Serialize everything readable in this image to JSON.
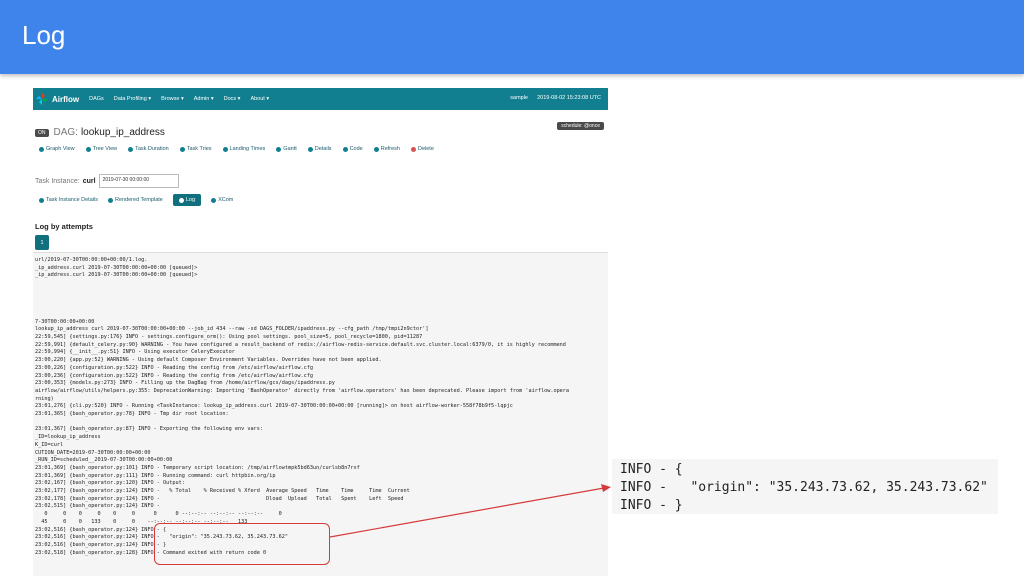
{
  "slide": {
    "title": "Log"
  },
  "navbar": {
    "brand": "Airflow",
    "items": [
      "DAGs",
      "Data Profiling ▾",
      "Browse ▾",
      "Admin ▾",
      "Docs ▾",
      "About ▾"
    ],
    "user": "sample",
    "datetime": "2019-08-02 15:23:08 UTC"
  },
  "dag": {
    "state_badge": "ON",
    "prefix": "DAG:",
    "name": "lookup_ip_address",
    "schedule_badge": "schedule: @once"
  },
  "toolbar": {
    "buttons": [
      "Graph View",
      "Tree View",
      "Task Duration",
      "Task Tries",
      "Landing Times",
      "Gantt",
      "Details",
      "Code",
      "Refresh",
      "Delete"
    ]
  },
  "task_instance": {
    "label": "Task Instance:",
    "name": "curl",
    "date": "2019-07-30 00:00:00"
  },
  "tabs": {
    "items": [
      "Task Instance Details",
      "Rendered Template",
      "Log",
      "XCom"
    ]
  },
  "log": {
    "heading": "Log by attempts",
    "attempt": "1",
    "lines": [
      "url/2019-07-30T00:00:00+00:00/1.log.",
      "_ip_address.curl 2019-07-30T00:00:00+00:00 [queued]>",
      "_ip_address.curl 2019-07-30T00:00:00+00:00 [queued]>",
      "",
      "",
      "",
      "",
      "",
      "7-30T00:00:00+00:00",
      "lookup_ip_address curl 2019-07-30T00:00:00+00:00 --job_id 434 --raw -sd DAGS_FOLDER/ipaddress.py --cfg_path /tmp/tmpi2n9ctor']",
      "22:59,545] {settings.py:176} INFO - settings.configure_orm(): Using pool settings. pool_size=5, pool_recycle=1800, pid=11287",
      "22:59,991] {default_celery.py:90} WARNING - You have configured a result_backend of redis://airflow-redis-service.default.svc.cluster.local:6379/0, it is highly recommend",
      "22:59,994] {__init__.py:51} INFO - Using executor CeleryExecutor",
      "23:00,220] {app.py:52} WARNING - Using default Composer Environment Variables. Overrides have not been applied.",
      "23:00,226] {configuration.py:522} INFO - Reading the config from /etc/airflow/airflow.cfg",
      "23:00,236] {configuration.py:522} INFO - Reading the config from /etc/airflow/airflow.cfg",
      "23:00,353] {models.py:273} INFO - Filling up the DagBag from /home/airflow/gcs/dags/ipaddress.py",
      "airflow/airflow/utils/helpers.py:355: DeprecationWarning: Importing 'BashOperator' directly from 'airflow.operators' has been deprecated. Please import from 'airflow.opera",
      "rning)",
      "23:01,276] {cli.py:520} INFO - Running <TaskInstance: lookup_ip_address.curl 2019-07-30T00:00:00+00:00 [running]> on host airflow-worker-558f78b9f5-lqpjc",
      "23:01,365] {bash_operator.py:78} INFO - Tmp dir root location:",
      "",
      "23:01,367] {bash_operator.py:87} INFO - Exporting the following env vars:",
      "_ID=lookup_ip_address",
      "K_ID=curl",
      "CUTION_DATE=2019-07-30T00:00:00+00:00",
      "_RUN_ID=scheduled__2019-07-30T00:00:00+00:00",
      "23:01,369] {bash_operator.py:101} INFO - Temporary script location: /tmp/airflowtmpk5bd63un/curlsb8n7rxf",
      "23:01,369] {bash_operator.py:111} INFO - Running command: curl httpbin.org/ip",
      "23:02,167] {bash_operator.py:120} INFO - Output:",
      "23:02,177] {bash_operator.py:124} INFO -   % Total    % Received % Xferd  Average Speed   Time    Time     Time  Current",
      "23:02,178] {bash_operator.py:124} INFO -                                  Dload  Upload   Total   Spent    Left  Speed",
      "23:02,515] {bash_operator.py:124} INFO -",
      "   0     0    0     0    0     0      0      0 --:--:-- --:--:-- --:--:--     0",
      "  45     0    0   133    0     0    --:--:-- --:--:-- --:--:--   133",
      "23:02,516] {bash_operator.py:124} INFO - {",
      "23:02,516] {bash_operator.py:124} INFO -   \"origin\": \"35.243.73.62, 35.243.73.62\"",
      "23:02,516] {bash_operator.py:124} INFO - }",
      "23:02,518] {bash_operator.py:128} INFO - Command exited with return code 0"
    ]
  },
  "zoom": {
    "lines": [
      "INFO - {",
      "INFO -   \"origin\": \"35.243.73.62, 35.243.73.62\"",
      "INFO - }"
    ]
  },
  "colors": {
    "header_blue": "#3f84ea",
    "airflow_teal": "#117f8f",
    "callout_red": "#d63a3a"
  }
}
